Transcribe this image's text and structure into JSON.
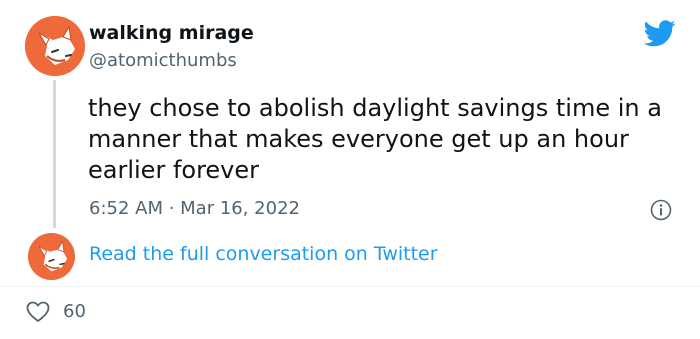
{
  "tweet": {
    "display_name": "walking mirage",
    "handle": "@atomicthumbs",
    "text": "they chose to abolish daylight savings time in a manner that makes everyone get up an hour earlier forever",
    "timestamp": "6:52 AM · Mar 16, 2022",
    "read_more_link": "Read the full conversation on Twitter",
    "like_count": "60"
  },
  "icons": {
    "brand": "twitter-bird-icon",
    "info": "info-icon",
    "like": "heart-icon",
    "avatar": "fox-avatar"
  },
  "colors": {
    "link": "#1d9bf0",
    "avatar_bg": "#ee6a3b",
    "muted_text": "#536471",
    "thread_line": "#cfd9de"
  }
}
